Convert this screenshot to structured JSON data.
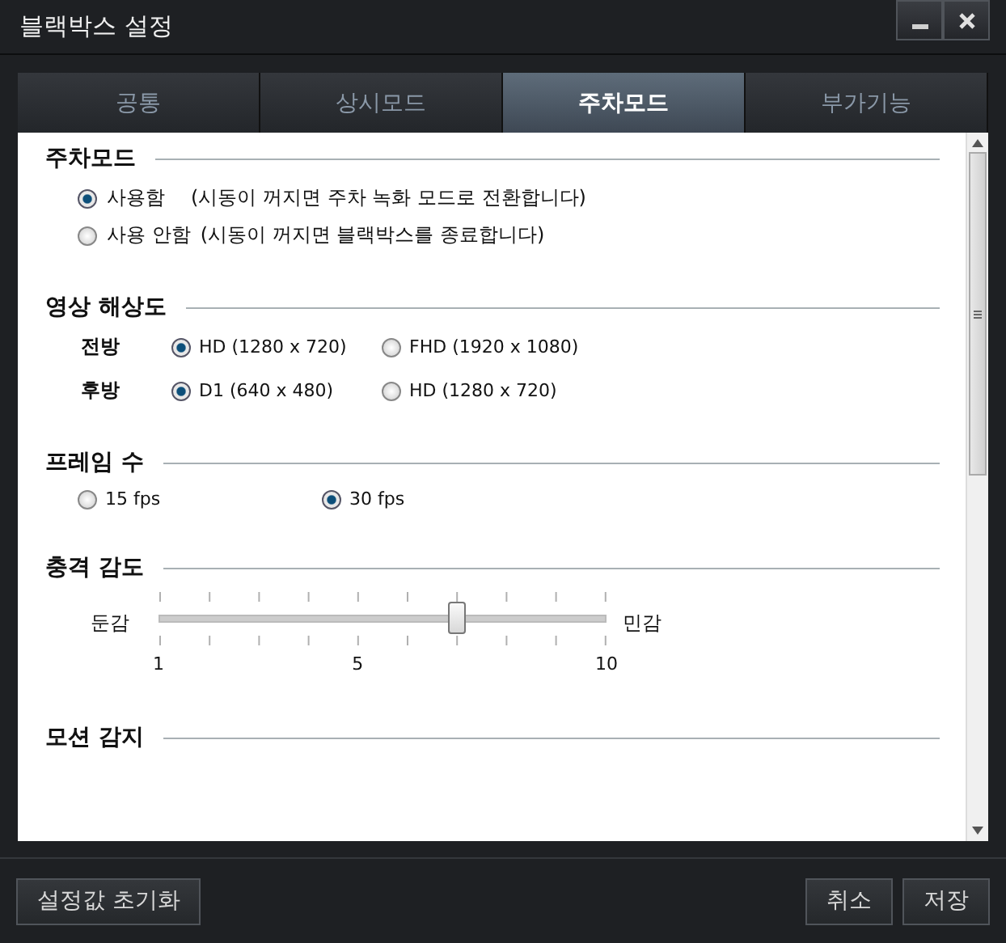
{
  "window": {
    "title": "블랙박스 설정"
  },
  "tabs": [
    {
      "label": "공통",
      "selected": false
    },
    {
      "label": "상시모드",
      "selected": false
    },
    {
      "label": "주차모드",
      "selected": true
    },
    {
      "label": "부가기능",
      "selected": false
    }
  ],
  "sections": [
    {
      "title": "주차모드",
      "kind": "radio-list",
      "options": [
        {
          "label": "사용함",
          "note": "(시동이 꺼지면 주차 녹화 모드로 전환합니다)",
          "selected": true
        },
        {
          "label": "사용 안함",
          "note": "(시동이 꺼지면 블랙박스를 종료합니다)",
          "selected": false
        }
      ]
    },
    {
      "title": "영상 해상도",
      "kind": "grid",
      "rows": [
        {
          "label": "전방",
          "options": [
            {
              "label": "HD (1280 x 720)",
              "selected": true
            },
            {
              "label": "FHD (1920 x 1080)",
              "selected": false
            }
          ]
        },
        {
          "label": "후방",
          "options": [
            {
              "label": "D1 (640 x 480)",
              "selected": true
            },
            {
              "label": "HD (1280 x 720)",
              "selected": false
            }
          ]
        }
      ]
    },
    {
      "title": "프레임 수",
      "kind": "radio-inline",
      "options": [
        {
          "label": "15 fps",
          "selected": false
        },
        {
          "label": "30 fps",
          "selected": true
        }
      ]
    },
    {
      "title": "충격 감도",
      "kind": "slider",
      "slider": {
        "min_label": "둔감",
        "max_label": "민감",
        "level": 0.667,
        "ticks": [
          "1",
          "5",
          "10"
        ]
      }
    },
    {
      "title": "모션 감지",
      "kind": "heading"
    }
  ],
  "buttons": {
    "reset": "설정값 초기화",
    "cancel": "취소",
    "save": "저장"
  }
}
